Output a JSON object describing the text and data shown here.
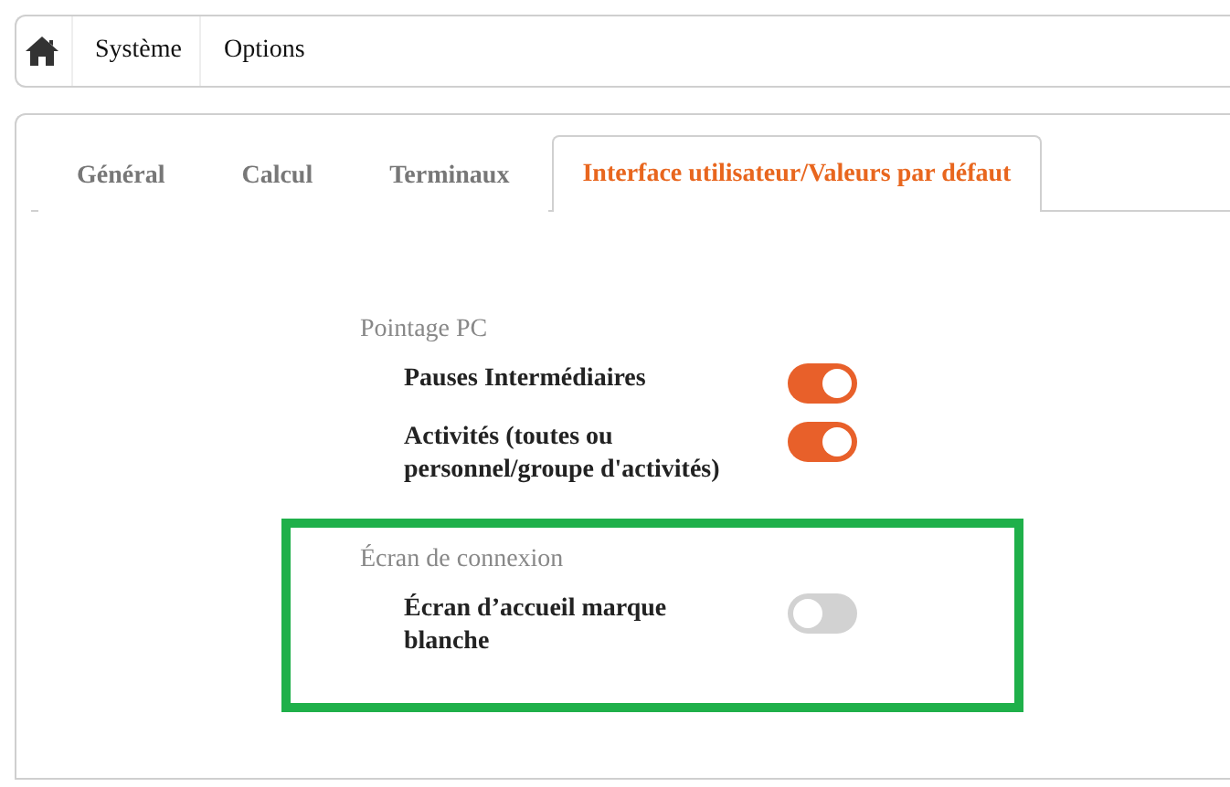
{
  "breadcrumb": [
    "Système",
    "Options"
  ],
  "tabs": [
    {
      "label": "Général",
      "selected": false
    },
    {
      "label": "Calcul",
      "selected": false
    },
    {
      "label": "Terminaux",
      "selected": false
    },
    {
      "label": "Interface utilisateur/Valeurs par défaut",
      "selected": true
    }
  ],
  "sections": [
    {
      "title": "Pointage PC",
      "highlighted": false,
      "settings": [
        {
          "label": "Pauses Intermédiaires",
          "on": true
        },
        {
          "label": "Activités (toutes ou personnel/groupe d'activités)",
          "on": true
        }
      ]
    },
    {
      "title": "Écran de connexion",
      "highlighted": true,
      "settings": [
        {
          "label": "Écran d’accueil marque blanche",
          "on": false
        }
      ]
    }
  ]
}
